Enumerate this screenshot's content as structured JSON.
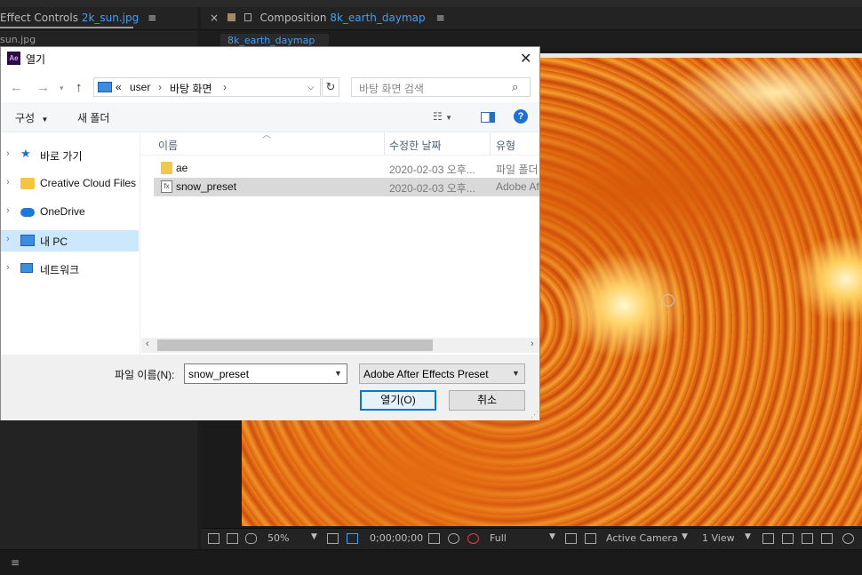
{
  "ae": {
    "effect_controls_label": "Effect Controls",
    "effect_controls_file": "2k_sun.jpg",
    "left_file": "sun.jpg",
    "composition_label": "Composition",
    "composition_name": "8k_earth_daymap",
    "comp_subtab": "8k_earth_daymap",
    "menu_glyph": "≡",
    "close_glyph": "×",
    "viewer_bar": {
      "zoom": "50%",
      "timecode": "0;00;00;00",
      "resolution": "Full",
      "camera": "Active Camera",
      "views": "1 View"
    }
  },
  "dialog": {
    "title": "열기",
    "app_icon_text": "Ae",
    "address": {
      "prefix": "«",
      "crumbs": [
        "user",
        "바탕 화면"
      ]
    },
    "search_placeholder": "바탕 화면 검색",
    "toolbar": {
      "organize": "구성",
      "new_folder": "새 폴더"
    },
    "nav_items": [
      {
        "label": "바로 가기",
        "icon": "star-icon"
      },
      {
        "label": "Creative Cloud Files",
        "icon": "creative-cloud-folder-icon"
      },
      {
        "label": "OneDrive",
        "icon": "cloud-icon"
      },
      {
        "label": "내 PC",
        "icon": "pc-icon",
        "selected": true
      },
      {
        "label": "네트워크",
        "icon": "network-icon"
      }
    ],
    "columns": {
      "name": "이름",
      "modified": "수정한 날짜",
      "type": "유형"
    },
    "files": [
      {
        "name": "ae",
        "modified": "2020-02-03 오후...",
        "type": "파일 폴더",
        "icon": "folder-icon"
      },
      {
        "name": "snow_preset",
        "modified": "2020-02-03 오후...",
        "type": "Adobe After Effects Preset",
        "icon": "preset-file-icon",
        "selected": true
      }
    ],
    "filename_label": "파일 이름(N):",
    "filename_value": "snow_preset",
    "filetype_value": "Adobe After Effects Preset",
    "open_button": "열기(O)",
    "cancel_button": "취소"
  },
  "colors": {
    "ae_blue": "#4a9cf0",
    "dialog_accent": "#0078d7",
    "selection": "#cce8ff"
  }
}
